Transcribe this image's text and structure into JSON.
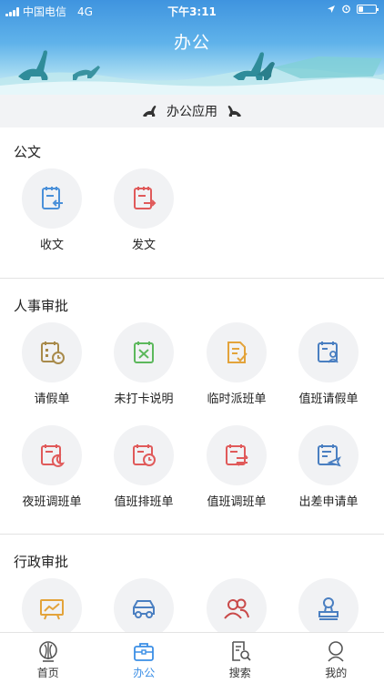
{
  "status_bar": {
    "carrier": "中国电信",
    "network": "4G",
    "time": "下午3:11",
    "battery_level": 0.3
  },
  "header": {
    "title": "办公"
  },
  "sub_header": {
    "title": "办公应用"
  },
  "sections": [
    {
      "title": "公文",
      "items": [
        {
          "label": "收文",
          "icon": "receive-document-icon",
          "color": "#4a90d9"
        },
        {
          "label": "发文",
          "icon": "send-document-icon",
          "color": "#e05a5a"
        }
      ]
    },
    {
      "title": "人事审批",
      "items": [
        {
          "label": "请假单",
          "icon": "leave-calendar-icon",
          "color": "#a88a4a"
        },
        {
          "label": "未打卡说明",
          "icon": "missed-clock-in-icon",
          "color": "#5cb85c"
        },
        {
          "label": "临时派班单",
          "icon": "temp-shift-icon",
          "color": "#e3a33a"
        },
        {
          "label": "值班请假单",
          "icon": "duty-leave-icon",
          "color": "#4a7fc1"
        },
        {
          "label": "夜班调班单",
          "icon": "night-shift-icon",
          "color": "#e05a5a"
        },
        {
          "label": "值班排班单",
          "icon": "duty-schedule-icon",
          "color": "#e05a5a"
        },
        {
          "label": "值班调班单",
          "icon": "duty-adjust-icon",
          "color": "#e05a5a"
        },
        {
          "label": "出差申请单",
          "icon": "business-trip-icon",
          "color": "#4a7fc1"
        }
      ]
    },
    {
      "title": "行政审批",
      "items": [
        {
          "label": "",
          "icon": "presentation-icon",
          "color": "#e3a33a"
        },
        {
          "label": "",
          "icon": "vehicle-icon",
          "color": "#4a7fc1"
        },
        {
          "label": "",
          "icon": "users-icon",
          "color": "#c94a4a"
        },
        {
          "label": "",
          "icon": "seal-icon",
          "color": "#4a7fc1"
        }
      ]
    }
  ],
  "tabbar": {
    "active": "办公",
    "tabs": [
      {
        "label": "首页",
        "icon": "home-icon"
      },
      {
        "label": "办公",
        "icon": "briefcase-icon"
      },
      {
        "label": "搜索",
        "icon": "search-document-icon"
      },
      {
        "label": "我的",
        "icon": "profile-icon"
      }
    ]
  }
}
